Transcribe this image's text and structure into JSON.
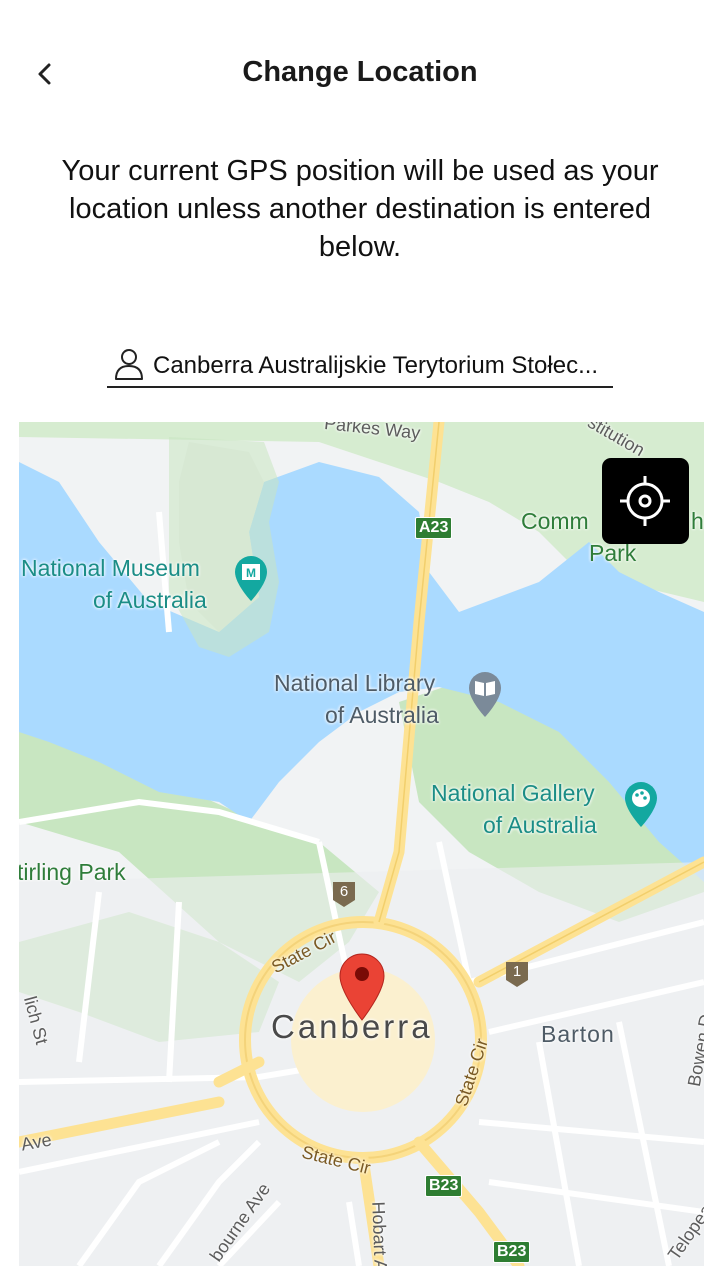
{
  "header": {
    "title": "Change Location",
    "back_icon": "chevron-left-icon"
  },
  "info": {
    "text": "Your current GPS position will be used as your location unless another destination is entered below."
  },
  "location_field": {
    "value": "Canberra Australijskie Terytorium Stołec...",
    "icon": "person-icon"
  },
  "map": {
    "labels": {
      "parkes_way": "Parkes Way",
      "constitution": "stitution",
      "commonwealth_line1": "Comm",
      "commonwealth_line1_tail": "h",
      "commonwealth_line2": "Park",
      "museum_line1": "National Museum",
      "museum_line2": "of Australia",
      "library_line1": "National Library",
      "library_line2": "of Australia",
      "gallery_line1": "National Gallery",
      "gallery_line2": "of Australia",
      "stirling_park": "tirling Park",
      "state_cir_1": "State Cir",
      "state_cir_2": "State Cir",
      "state_cir_3": "State Cir",
      "city": "Canberra",
      "barton": "Barton",
      "ave_left": "Ave",
      "lich_st": "lich St",
      "melbourne_ave": "bourne Ave",
      "hobart_ave": "Hobart A",
      "bowen": "Bowen D",
      "telopea": "Telopea"
    },
    "shields": {
      "a23": "A23",
      "b23_1": "B23",
      "b23_2": "B23"
    },
    "route_markers": {
      "m6": "6",
      "m1": "1"
    },
    "colors": {
      "water": "#aadaff",
      "park": "#c8e6c1",
      "road_major": "#fde293",
      "land": "#f1f3f4",
      "pin": "#ea4335"
    }
  },
  "gps_button": {
    "icon": "crosshair-icon"
  },
  "pin": {
    "icon": "map-pin-icon"
  }
}
